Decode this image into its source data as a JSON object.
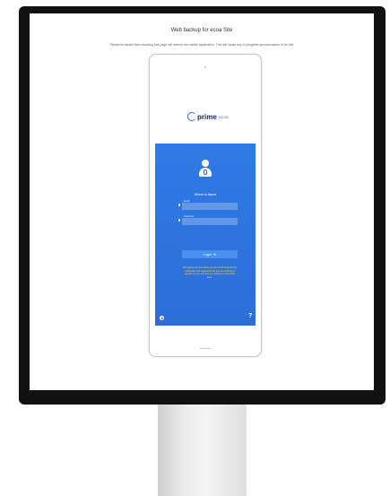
{
  "page": {
    "title": "Web backup for ecoa Site",
    "warning": "Please be aware that reloading this page will refresh the mobile application. This will cause any in-progress questionnaires to be lost"
  },
  "app": {
    "logo_text": "prime",
    "logo_subtext": "eCOA",
    "welcome": "Where to Name",
    "email_label": "Email",
    "password_label": "Password",
    "login_label": "Login",
    "disclaimer": "By logging into this tablet you are confirming that the credentials and password that you are entering in specific to you, and that you belong to your study team.",
    "help_label": "?",
    "icons": {
      "user": "user-icon",
      "settings": "settings-icon",
      "help": "help-icon",
      "arrow": "arrow-right-icon"
    }
  },
  "colors": {
    "monitor_bezel": "#111111",
    "login_blue": "#2c6ed8",
    "button_blue": "#4a90ef",
    "disclaimer_yellow": "#ffd24a"
  }
}
